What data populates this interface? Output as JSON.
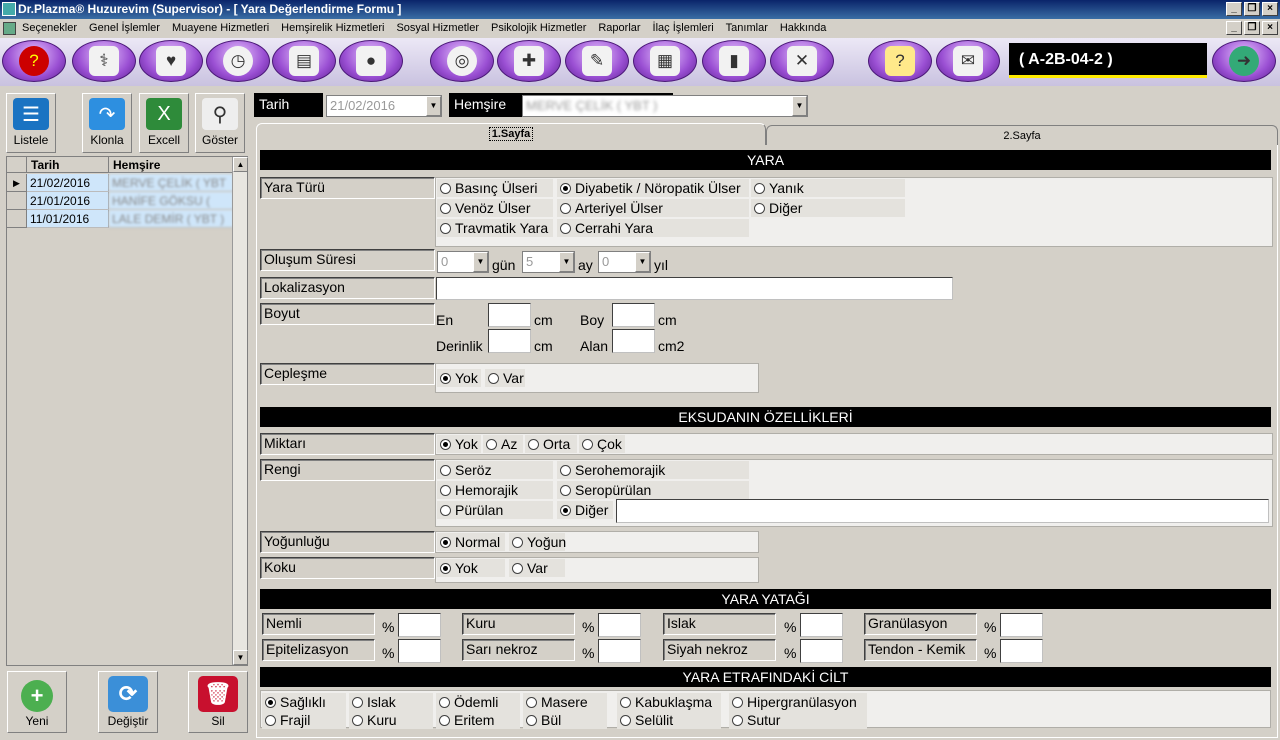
{
  "window": {
    "title": "Dr.Plazma® Huzurevim (Supervisor) - [ Yara Değerlendirme Formu ]"
  },
  "menu": [
    "Seçenekler",
    "Genel İşlemler",
    "Muayene Hizmetleri",
    "Hemşirelik Hizmetleri",
    "Sosyal Hizmetler",
    "Psikolojik Hizmetler",
    "Raporlar",
    "İlaç İşlemleri",
    "Tanımlar",
    "Hakkında"
  ],
  "toolbar": {
    "room_code": "( A-2B-04-2 )",
    "icons": [
      "help-head-icon",
      "doctors-icon",
      "stethoscope-icon",
      "stopwatch-icon",
      "document-icon",
      "pills-icon",
      "spiral-icon",
      "bandage-icon",
      "tools-chart-icon",
      "clipboard-icon",
      "bar-chart-icon",
      "wrench-icon",
      "note-icon",
      "mail-icon",
      "exit-globe-icon"
    ]
  },
  "left": {
    "buttons": {
      "list": "Listele",
      "clone": "Klonla",
      "excel": "Excell",
      "show": "Göster"
    },
    "grid": {
      "col_date": "Tarih",
      "col_nurse": "Hemşire",
      "rows": [
        {
          "date": "21/02/2016",
          "nurse": "MERVE ÇELİK ( YBT )"
        },
        {
          "date": "21/01/2016",
          "nurse": "HANİFE GÖKSU ( YBT )"
        },
        {
          "date": "11/01/2016",
          "nurse": "LALE DEMİR ( YBT )"
        }
      ]
    },
    "bottom": {
      "new": "Yeni",
      "change": "Değiştir",
      "delete": "Sil"
    }
  },
  "header": {
    "date_label": "Tarih",
    "date_value": "21/02/2016",
    "nurse_label": "Hemşire",
    "nurse_value": "MERVE ÇELİK ( YBT )"
  },
  "tabs": [
    "1.Sayfa",
    "2.Sayfa"
  ],
  "yara": {
    "title": "YARA",
    "type_label": "Yara Türü",
    "types": [
      {
        "label": "Basınç Ülseri",
        "on": false
      },
      {
        "label": "Diyabetik / Nöropatik Ülser",
        "on": true
      },
      {
        "label": "Yanık",
        "on": false
      },
      {
        "label": "Venöz Ülser",
        "on": false
      },
      {
        "label": "Arteriyel Ülser",
        "on": false
      },
      {
        "label": "Diğer",
        "on": false
      },
      {
        "label": "Travmatik Yara",
        "on": false
      },
      {
        "label": "Cerrahi Yara",
        "on": false
      }
    ],
    "duration_label": "Oluşum Süresi",
    "day": "0",
    "day_unit": "gün",
    "month": "5",
    "month_unit": "ay",
    "year": "0",
    "year_unit": "yıl",
    "loc_label": "Lokalizasyon",
    "size_label": "Boyut",
    "en": "En",
    "boy": "Boy",
    "depth": "Derinlik",
    "area": "Alan",
    "cm": "cm",
    "cm2": "cm2",
    "pocket_label": "Cepleşme",
    "pocket": [
      {
        "label": "Yok",
        "on": true
      },
      {
        "label": "Var",
        "on": false
      }
    ]
  },
  "eks": {
    "title": "EKSUDANIN ÖZELLİKLERİ",
    "amount_label": "Miktarı",
    "amount": [
      {
        "label": "Yok",
        "on": true
      },
      {
        "label": "Az",
        "on": false
      },
      {
        "label": "Orta",
        "on": false
      },
      {
        "label": "Çok",
        "on": false
      }
    ],
    "color_label": "Rengi",
    "colors": [
      {
        "label": "Seröz",
        "on": false
      },
      {
        "label": "Serohemorajik",
        "on": false
      },
      {
        "label": "Hemorajik",
        "on": false
      },
      {
        "label": "Seropürülan",
        "on": false
      },
      {
        "label": "Pürülan",
        "on": false
      },
      {
        "label": "Diğer",
        "on": true
      }
    ],
    "density_label": "Yoğunluğu",
    "density": [
      {
        "label": "Normal",
        "on": true
      },
      {
        "label": "Yoğun",
        "on": false
      }
    ],
    "smell_label": "Koku",
    "smell": [
      {
        "label": "Yok",
        "on": true
      },
      {
        "label": "Var",
        "on": false
      }
    ]
  },
  "bed": {
    "title": "YARA YATAĞI",
    "pct": "%",
    "items": [
      "Nemli",
      "Kuru",
      "Islak",
      "Granülasyon",
      "Epitelizasyon",
      "Sarı nekroz",
      "Siyah nekroz",
      "Tendon - Kemik"
    ]
  },
  "skin": {
    "title": "YARA ETRAFINDAKİ CİLT",
    "opts": [
      {
        "label": "Sağlıklı",
        "on": true
      },
      {
        "label": "Islak",
        "on": false
      },
      {
        "label": "Ödemli",
        "on": false
      },
      {
        "label": "Masere",
        "on": false
      },
      {
        "label": "Kabuklaşma",
        "on": false
      },
      {
        "label": "Hipergranülasyon",
        "on": false
      },
      {
        "label": "Frajil",
        "on": false
      },
      {
        "label": "Kuru",
        "on": false
      },
      {
        "label": "Eritem",
        "on": false
      },
      {
        "label": "Bül",
        "on": false
      },
      {
        "label": "Selülit",
        "on": false
      },
      {
        "label": "Sutur",
        "on": false
      }
    ]
  }
}
